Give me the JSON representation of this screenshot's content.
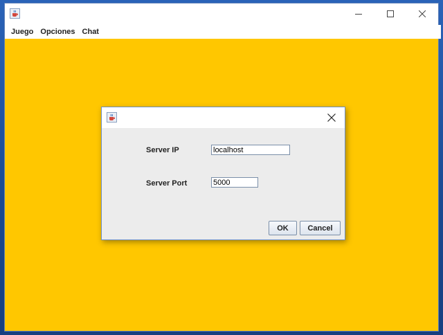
{
  "window": {
    "menu": [
      "Juego",
      "Opciones",
      "Chat"
    ],
    "app_icon": "java-cup-icon"
  },
  "colors": {
    "content_background": "#ffc700",
    "dialog_background": "#ececec"
  },
  "dialog": {
    "server_ip_label": "Server IP",
    "server_ip_value": "localhost",
    "server_port_label": "Server Port",
    "server_port_value": "5000",
    "ok_label": "OK",
    "cancel_label": "Cancel"
  }
}
